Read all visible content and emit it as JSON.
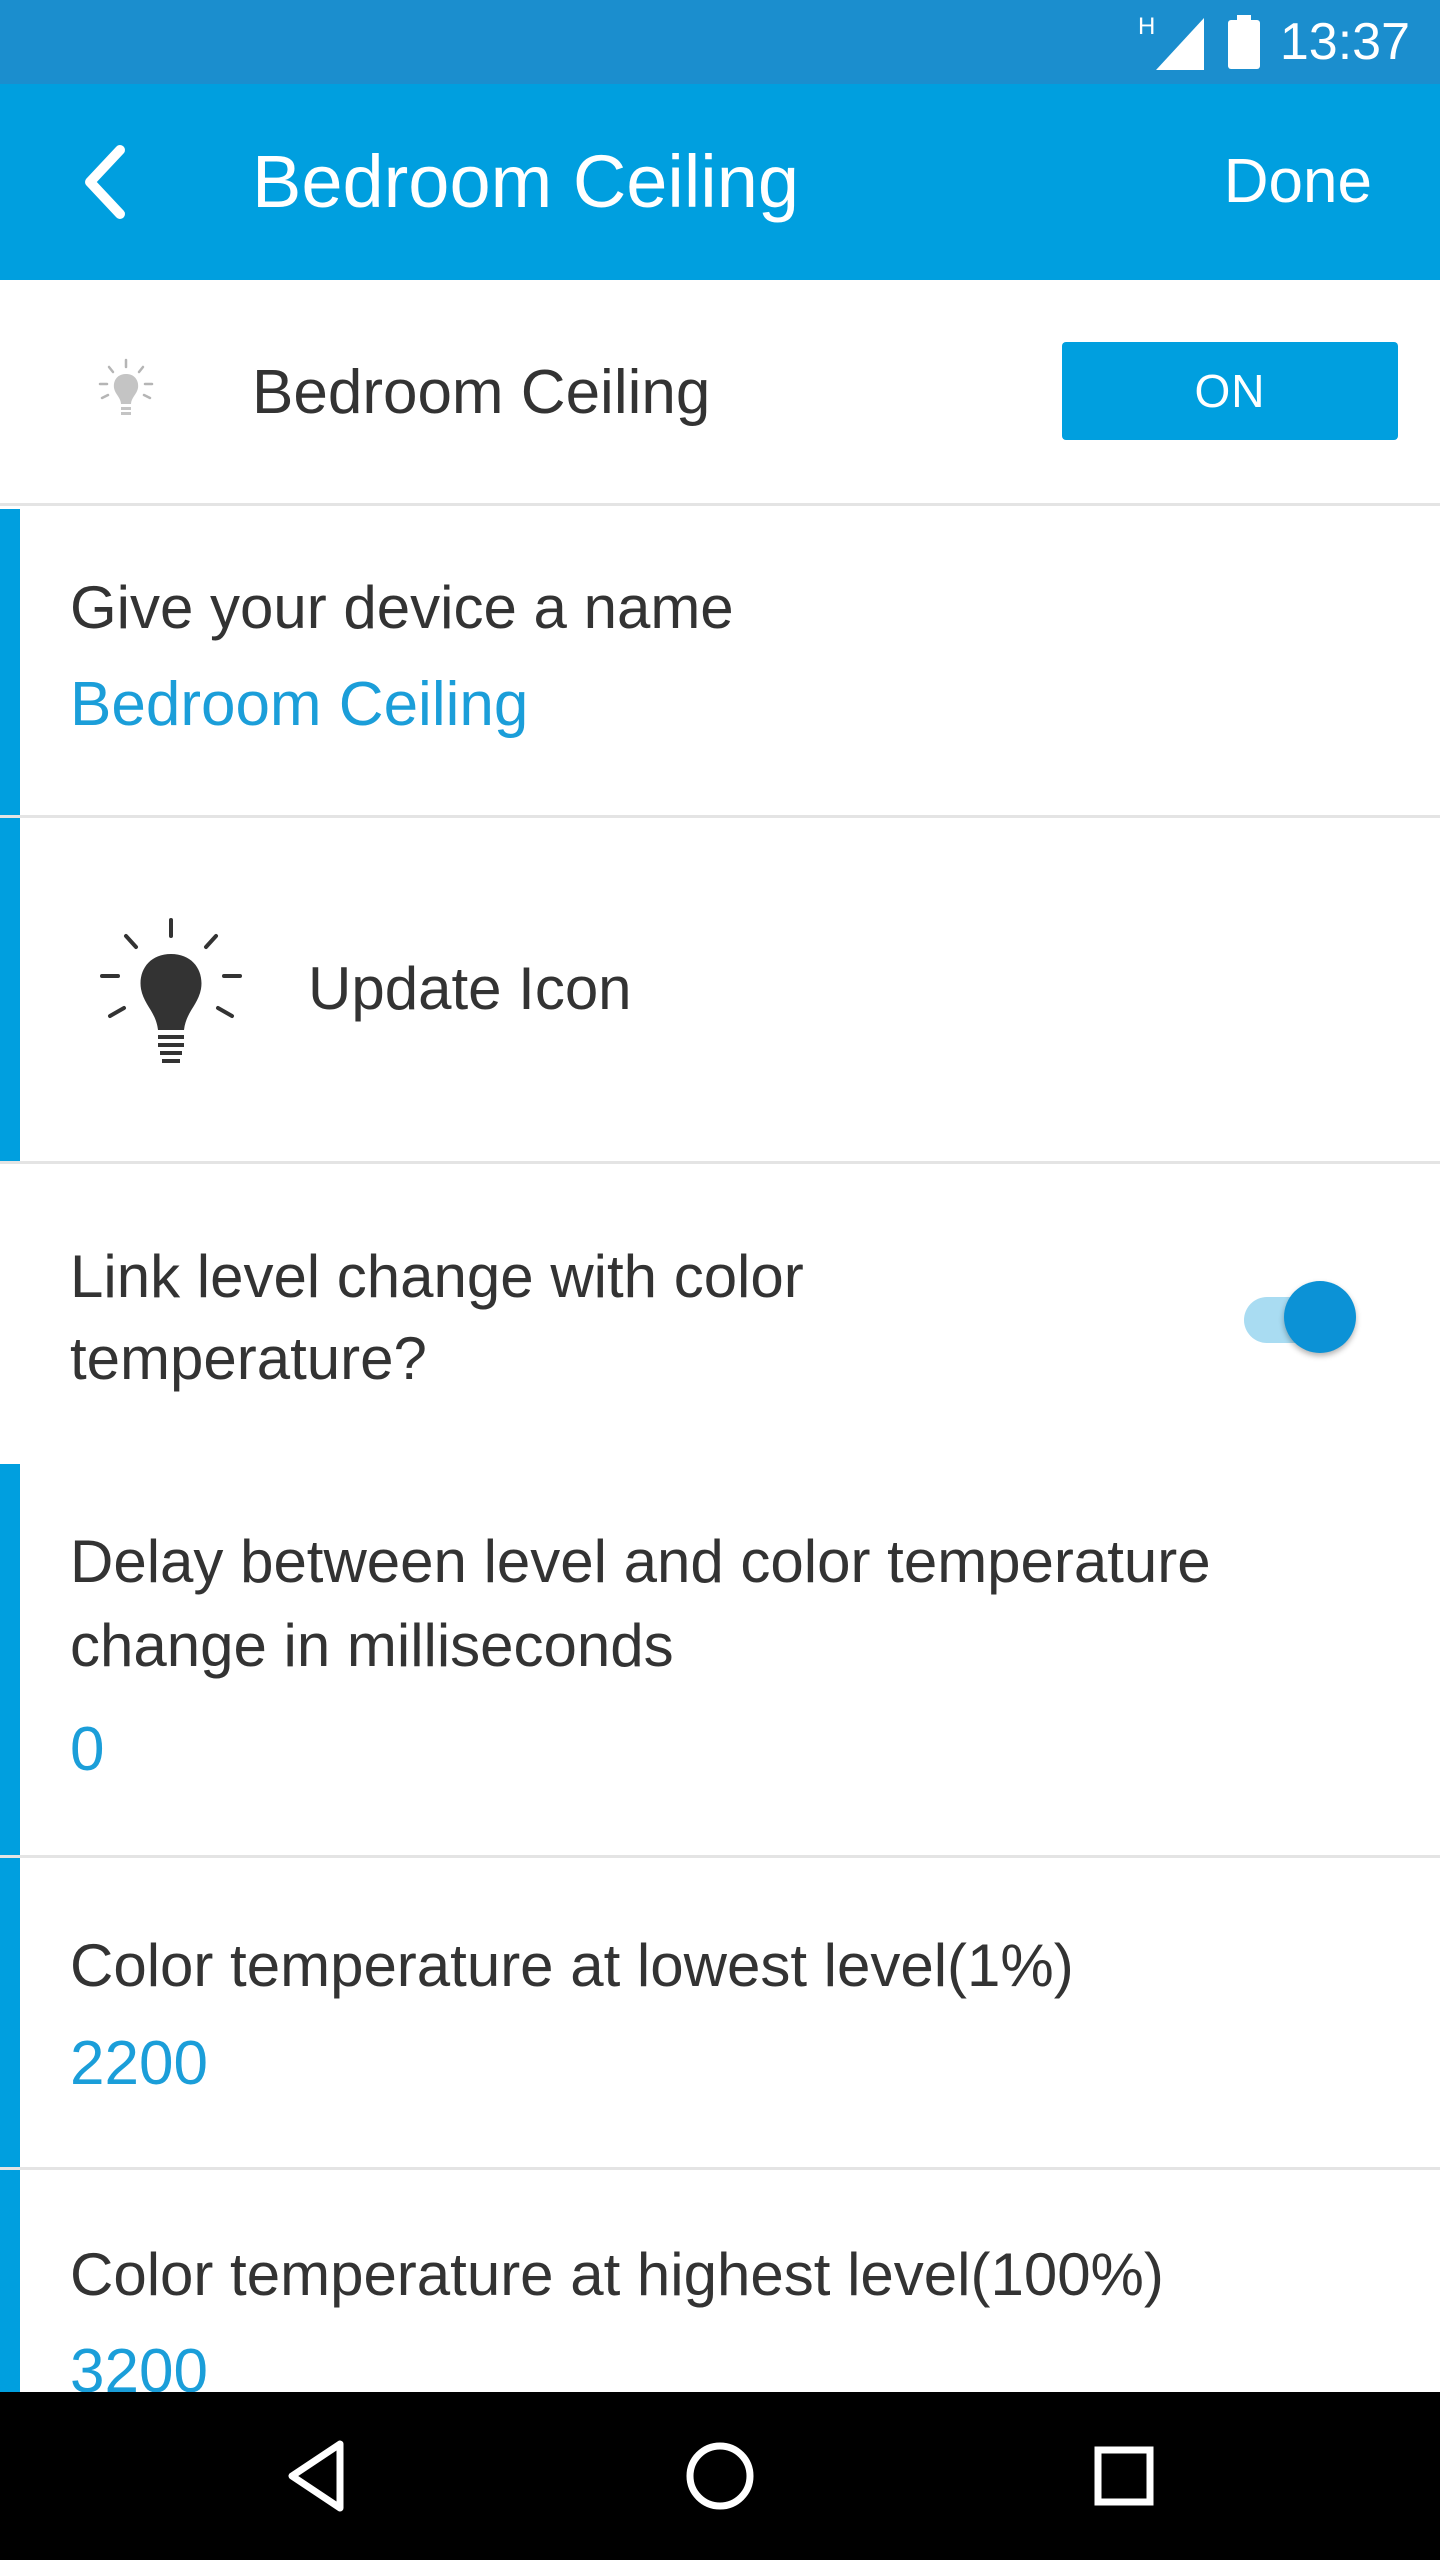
{
  "status_bar": {
    "network_label": "H",
    "time": "13:37"
  },
  "app_bar": {
    "title": "Bedroom Ceiling",
    "done_label": "Done"
  },
  "device": {
    "name": "Bedroom Ceiling",
    "power_button_label": "ON"
  },
  "settings": {
    "name_field": {
      "label": "Give your device a name",
      "value": "Bedroom Ceiling"
    },
    "update_icon": {
      "label": "Update Icon"
    },
    "link_level": {
      "label_line1": "Link level change with color",
      "label_line2": "temperature?",
      "enabled": true
    },
    "delay": {
      "label_line1": "Delay between level and color temperature",
      "label_line2": "change in milliseconds",
      "value": "0"
    },
    "lowest_level": {
      "label": "Color temperature at lowest level(1%)",
      "value": "2200"
    },
    "highest_level": {
      "label": "Color temperature at highest level(100%)",
      "value": "3200"
    }
  },
  "colors": {
    "status_bar": "#1b8ece",
    "app_bar": "#009fdf",
    "accent": "#009fdf",
    "value_text": "#1b9ed9"
  }
}
